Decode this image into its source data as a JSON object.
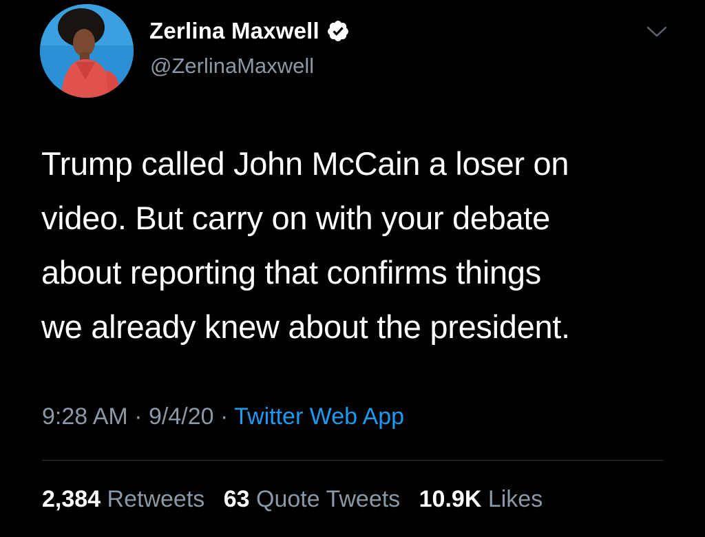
{
  "author": {
    "display_name": "Zerlina Maxwell",
    "handle": "@ZerlinaMaxwell",
    "verified": true,
    "avatar_icon": "profile-photo"
  },
  "menu": {
    "icon": "chevron-down-icon"
  },
  "tweet": {
    "text_lines": [
      "Trump called John McCain a loser on",
      "video. But carry on with your debate",
      "about reporting that confirms things",
      "we already knew about the president."
    ],
    "time": "9:28 AM",
    "date": "9/4/20",
    "separator": "·",
    "source": "Twitter Web App"
  },
  "stats": {
    "retweets_count": "2,384",
    "retweets_label": "Retweets",
    "quotes_count": "63",
    "quotes_label": "Quote Tweets",
    "likes_count": "10.9K",
    "likes_label": "Likes"
  },
  "colors": {
    "background": "#000000",
    "text": "#ffffff",
    "secondary_text": "#8b98a5",
    "link": "#1d9bf0",
    "divider": "#2f3336",
    "verified_badge": "#ffffff"
  }
}
